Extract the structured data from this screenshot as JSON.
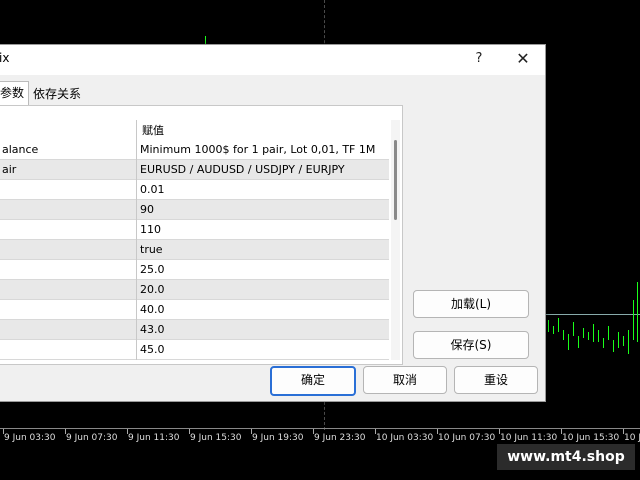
{
  "window": {
    "title": "ix",
    "help_icon": "?",
    "close_icon": "✕"
  },
  "tabs": [
    {
      "label": "参数"
    },
    {
      "label": "依存关系"
    }
  ],
  "table": {
    "value_header": "赋值",
    "rows": [
      {
        "name": "alance",
        "value": "Minimum 1000$ for 1 pair, Lot 0,01, TF 1M"
      },
      {
        "name": "air",
        "value": "EURUSD / AUDUSD / USDJPY / EURJPY"
      },
      {
        "name": "",
        "value": "0.01"
      },
      {
        "name": "",
        "value": "90"
      },
      {
        "name": "",
        "value": "110"
      },
      {
        "name": "",
        "value": "true"
      },
      {
        "name": "",
        "value": "25.0"
      },
      {
        "name": "",
        "value": "20.0"
      },
      {
        "name": "",
        "value": "40.0"
      },
      {
        "name": "",
        "value": "43.0"
      },
      {
        "name": "",
        "value": "45.0"
      }
    ]
  },
  "side_buttons": {
    "load": "加载(L)",
    "save": "保存(S)"
  },
  "footer_buttons": {
    "ok": "确定",
    "cancel": "取消",
    "reset": "重设"
  },
  "time_axis": [
    "9 Jun 03:30",
    "9 Jun 07:30",
    "9 Jun 11:30",
    "9 Jun 15:30",
    "9 Jun 19:30",
    "9 Jun 23:30",
    "10 Jun 03:30",
    "10 Jun 07:30",
    "10 Jun 11:30",
    "10 Jun 15:30",
    "10 Jun"
  ],
  "watermark": "www.mt4.shop",
  "colors": {
    "chart_bg": "#000000",
    "candle": "#1aff1a",
    "accent": "#2a6fd6"
  }
}
